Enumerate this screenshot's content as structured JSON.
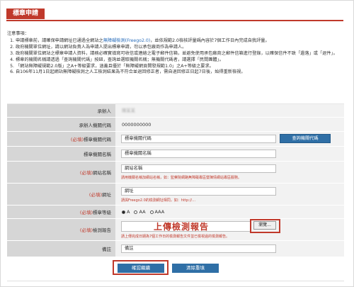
{
  "page": {
    "title": "標章申請"
  },
  "notes": {
    "heading": "注意事項：",
    "items": [
      {
        "before": "申請標章前，請確保申請網址已通過全網站之",
        "link": "無障礙檢測(Freego2.0)",
        "after": "，並依規範2.0檢核評量碼內容於7個工作日內完成自我評量。"
      },
      {
        "before": "政府機關單位網址，請以網站負責人為申請人提出標章申請，勿以承包廠商作為申請人。",
        "link": "",
        "after": ""
      },
      {
        "before": "政府機關單位網站之標章申請人資料，請務必確實填寫可收信或連絡之電子郵件信箱，並避免使用承包廠商之郵件信箱進行登錄，以確保信件不致「遺落」或「退件」。",
        "link": "",
        "after": ""
      },
      {
        "before": "標章的機關名稱請透過「查詢機關代碼」按鈕，查詢並選取機關名稱；無機關代碼者，請選擇「民間團體」。",
        "link": "",
        "after": ""
      },
      {
        "before": "「網站無障礙規範2.0版」之A+等級要求，涵蓋且優於「無障礙網頁開發規範1.0」之A+等級之要求。",
        "link": "",
        "after": ""
      },
      {
        "before": "自106年11月1日起網站無障礙檢測之人工檢測結果為不符合並退回修正者，需自退回修正日起7日後，始得重新檢視。",
        "link": "",
        "after": ""
      }
    ]
  },
  "form": {
    "applicant": {
      "label": "承辦人",
      "value": "陳某某"
    },
    "phone": {
      "label": "承辦人機關代碼",
      "value": "0000000000"
    },
    "org_code": {
      "req": "(必填)",
      "label": "標章機關代碼",
      "placeholder": "標章機關代碼",
      "button": "查詢機關代碼"
    },
    "org_name": {
      "label": "標章機關名稱",
      "placeholder": "標章機關名稱"
    },
    "site_name": {
      "req": "(必填)",
      "label": "網站名稱",
      "placeholder": "網站名稱",
      "hint": "請用機關名稱加網站名稱，如：監察院網路無障礙專區暨陳情網站專區服務。"
    },
    "url": {
      "req": "(必填)",
      "label": "網址",
      "placeholder": "網址",
      "hint": "請與Freego2.0的檢測網址相同，如：http://…"
    },
    "level": {
      "req": "(必填)",
      "label": "標章等級",
      "options": [
        "A",
        "AA",
        "AAA"
      ],
      "selected": "A"
    },
    "report": {
      "req": "(必填)",
      "label": "檢測報告",
      "overlay": "上傳檢測報告",
      "browse": "瀏覽...",
      "hint": "請上傳完成日期為7個工作日的檢測報告文件並已檢視過的檢測報告。"
    },
    "remark": {
      "label": "備註",
      "placeholder": "備註"
    }
  },
  "buttons": {
    "confirm": "確認繼續",
    "clear": "清除重填"
  },
  "colors": {
    "accent": "#c0392b",
    "button": "#2f6fa6",
    "label_bg": "#d6d6d6",
    "value_bg": "#f2f2f2"
  }
}
